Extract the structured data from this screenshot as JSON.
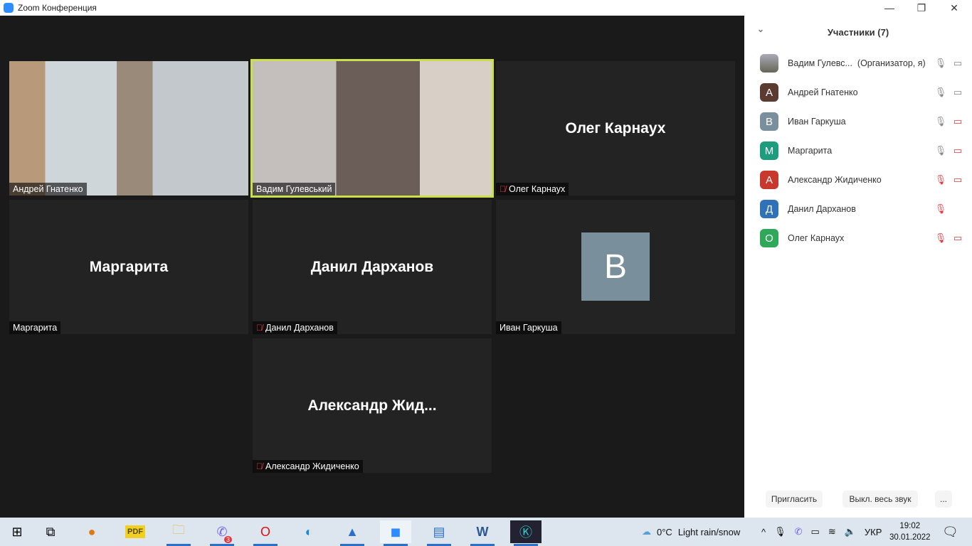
{
  "window": {
    "title": "Zoom Конференция",
    "minimize": "—",
    "restore": "❐",
    "close": "✕"
  },
  "tiles": [
    {
      "name": "Андрей Гнатенко",
      "big": "",
      "muted": false,
      "video": true
    },
    {
      "name": "Вадим Гулевський",
      "big": "",
      "muted": false,
      "video": true,
      "active": true
    },
    {
      "name": "Олег Карнаух",
      "big": "Олег Карнаух",
      "muted": true
    },
    {
      "name": "Маргарита",
      "big": "Маргарита",
      "muted": false
    },
    {
      "name": "Данил Дарханов",
      "big": "Данил Дарханов",
      "muted": true
    },
    {
      "name": "Иван Гаркуша",
      "big": "",
      "avatar_letter": "В",
      "muted": false
    },
    {
      "name": "Александр Жидиченко",
      "big": "Александр  Жид...",
      "muted": true
    }
  ],
  "panel": {
    "title": "Участники (7)",
    "participants": [
      {
        "name": "Вадим Гулевс...",
        "role": "(Организатор, я)",
        "avatar": "",
        "color": "#8a8f7a",
        "mic": "on",
        "cam": "on"
      },
      {
        "name": "Андрей Гнатенко",
        "role": "",
        "avatar": "А",
        "color": "#5b3a31",
        "mic": "on",
        "cam": "on"
      },
      {
        "name": "Иван Гаркуша",
        "role": "",
        "avatar": "В",
        "color": "#7a8f9c",
        "mic": "on",
        "cam": "off"
      },
      {
        "name": "Маргарита",
        "role": "",
        "avatar": "М",
        "color": "#1e9d7e",
        "mic": "on",
        "cam": "off"
      },
      {
        "name": "Александр Жидиченко",
        "role": "",
        "avatar": "А",
        "color": "#c8382c",
        "mic": "off",
        "cam": "off"
      },
      {
        "name": "Данил Дарханов",
        "role": "",
        "avatar": "Д",
        "color": "#2f72b8",
        "mic": "off",
        "cam": "none"
      },
      {
        "name": "Олег Карнаух",
        "role": "",
        "avatar": "О",
        "color": "#2fa85a",
        "mic": "off",
        "cam": "off"
      }
    ],
    "invite": "Пригласить",
    "mute_all": "Выкл. весь звук",
    "more": "..."
  },
  "taskbar": {
    "viber_badge": "3",
    "weather_temp": "0°C",
    "weather_text": "Light rain/snow",
    "lang": "УКР",
    "time": "19:02",
    "date": "30.01.2022"
  }
}
